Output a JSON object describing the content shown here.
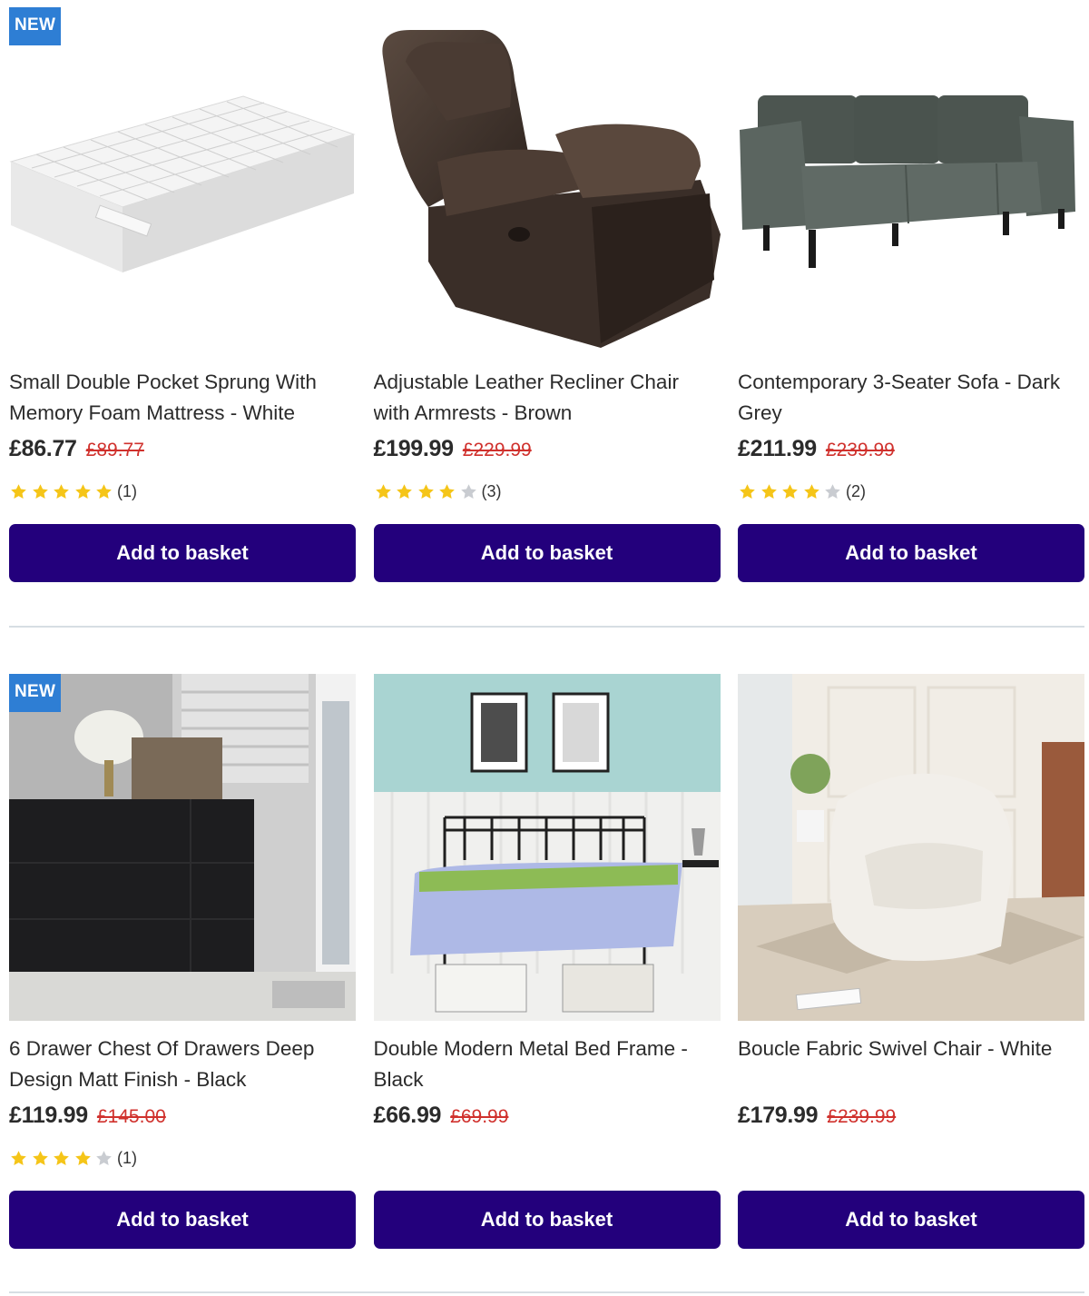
{
  "button_label": "Add to basket",
  "colors": {
    "button": "#23007c",
    "badge": "#2e7ed4",
    "was_price": "#d0312d",
    "star_on": "#f5c518",
    "star_off": "#c9ccd1"
  },
  "products": [
    {
      "badge": "NEW",
      "title": "Small Double Pocket Sprung With Memory Foam Mattress - White",
      "price": "£86.77",
      "was": "£89.77",
      "stars": 5,
      "reviews": "(1)",
      "image": "mattress-image"
    },
    {
      "badge": "",
      "title": "Adjustable Leather Recliner Chair with Armrests - Brown",
      "price": "£199.99",
      "was": "£229.99",
      "stars": 4,
      "reviews": "(3)",
      "image": "recliner-image"
    },
    {
      "badge": "",
      "title": "Contemporary 3-Seater Sofa - Dark Grey",
      "price": "£211.99",
      "was": "£239.99",
      "stars": 4,
      "reviews": "(2)",
      "image": "sofa-image"
    },
    {
      "badge": "NEW",
      "title": "6 Drawer Chest Of Drawers Deep Design Matt Finish - Black",
      "price": "£119.99",
      "was": "£145.00",
      "stars": 4,
      "reviews": "(1)",
      "image": "chest-of-drawers-image"
    },
    {
      "badge": "",
      "title": "Double Modern Metal Bed Frame - Black",
      "price": "£66.99",
      "was": "£69.99",
      "stars": null,
      "reviews": "",
      "image": "bed-frame-image"
    },
    {
      "badge": "",
      "title": "Boucle Fabric Swivel Chair - White",
      "price": "£179.99",
      "was": "£239.99",
      "stars": null,
      "reviews": "",
      "image": "swivel-chair-image"
    }
  ]
}
